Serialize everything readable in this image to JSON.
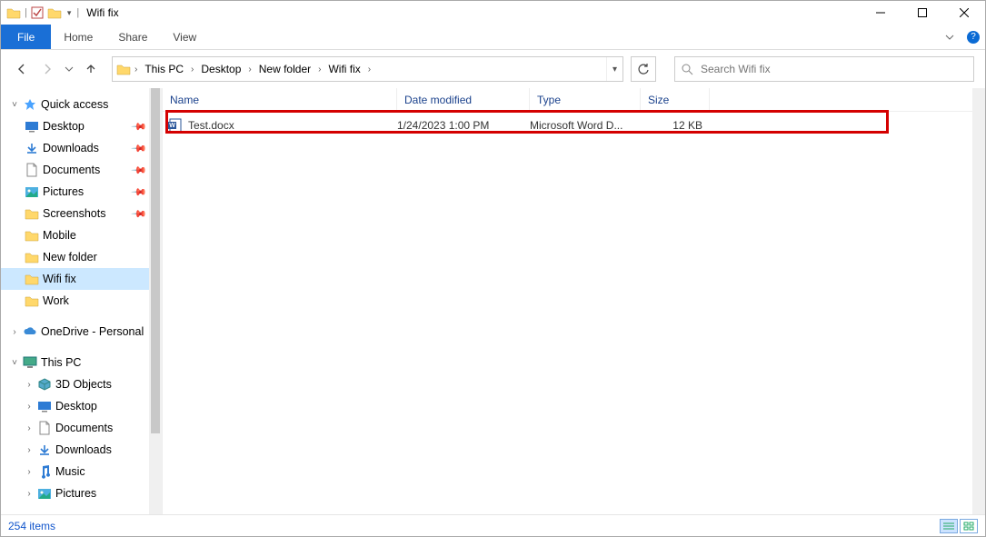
{
  "window": {
    "title": "Wifi fix"
  },
  "ribbon": {
    "file": "File",
    "tabs": [
      "Home",
      "Share",
      "View"
    ]
  },
  "address": {
    "crumbs": [
      "This PC",
      "Desktop",
      "New folder",
      "Wifi fix"
    ]
  },
  "search": {
    "placeholder": "Search Wifi fix"
  },
  "nav": {
    "quick_access": "Quick access",
    "qa_items": [
      {
        "label": "Desktop",
        "pin": true,
        "icon": "desktop"
      },
      {
        "label": "Downloads",
        "pin": true,
        "icon": "downloads"
      },
      {
        "label": "Documents",
        "pin": true,
        "icon": "documents"
      },
      {
        "label": "Pictures",
        "pin": true,
        "icon": "pictures"
      },
      {
        "label": "Screenshots",
        "pin": true,
        "icon": "folder"
      },
      {
        "label": "Mobile",
        "pin": false,
        "icon": "folder"
      },
      {
        "label": "New folder",
        "pin": false,
        "icon": "folder"
      },
      {
        "label": "Wifi fix",
        "pin": false,
        "icon": "folder",
        "selected": true
      },
      {
        "label": "Work",
        "pin": false,
        "icon": "folder"
      }
    ],
    "onedrive": "OneDrive - Personal",
    "this_pc": "This PC",
    "pc_items": [
      {
        "label": "3D Objects",
        "icon": "3d"
      },
      {
        "label": "Desktop",
        "icon": "desktop"
      },
      {
        "label": "Documents",
        "icon": "documents"
      },
      {
        "label": "Downloads",
        "icon": "downloads"
      },
      {
        "label": "Music",
        "icon": "music"
      },
      {
        "label": "Pictures",
        "icon": "pictures"
      }
    ]
  },
  "columns": {
    "name": "Name",
    "date": "Date modified",
    "type": "Type",
    "size": "Size"
  },
  "files": [
    {
      "name": "Test.docx",
      "date": "1/24/2023 1:00 PM",
      "type": "Microsoft Word D...",
      "size": "12 KB"
    }
  ],
  "status": {
    "count": "254 items"
  },
  "help_glyph": "?"
}
